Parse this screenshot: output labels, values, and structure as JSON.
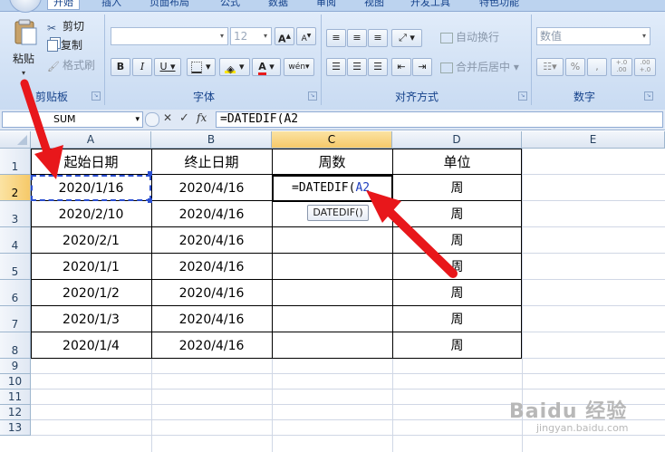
{
  "ribbon": {
    "tabs": [
      "开始",
      "插入",
      "页面布局",
      "公式",
      "数据",
      "审阅",
      "视图",
      "开发工具",
      "特色功能"
    ],
    "clipboard": {
      "paste": "粘贴",
      "cut": "剪切",
      "copy": "复制",
      "format_painter": "格式刷",
      "group": "剪贴板"
    },
    "font": {
      "font_size": "12",
      "bold": "B",
      "italic": "I",
      "underline": "U",
      "grow": "A",
      "shrink": "A",
      "group": "字体",
      "font_color_letter": "A",
      "phonetic": "wén"
    },
    "alignment": {
      "wrap": "自动换行",
      "merge": "合并后居中",
      "group": "对齐方式"
    },
    "number": {
      "format": "数值",
      "percent": "%",
      "comma": ",",
      "inc_decimal": "+.0\n.00",
      "dec_decimal": ".00\n+.0",
      "group": "数字"
    }
  },
  "formula_bar": {
    "name_box": "SUM",
    "cancel": "✕",
    "enter": "✓",
    "fx": "fx",
    "formula": "=DATEDIF(A2"
  },
  "grid": {
    "columns": [
      "A",
      "B",
      "C",
      "D",
      "E"
    ],
    "rows": [
      "1",
      "2",
      "3",
      "4",
      "5",
      "6",
      "7",
      "8",
      "9",
      "10",
      "11",
      "12",
      "13"
    ],
    "header_row": [
      "起始日期",
      "终止日期",
      "周数",
      "单位"
    ],
    "data_rows": [
      [
        "2020/1/16",
        "2020/4/16",
        "=DATEDIF(A2",
        "周"
      ],
      [
        "2020/2/10",
        "2020/4/16",
        "",
        "周"
      ],
      [
        "2020/2/1",
        "2020/4/16",
        "",
        "周"
      ],
      [
        "2020/1/1",
        "2020/4/16",
        "",
        "周"
      ],
      [
        "2020/1/2",
        "2020/4/16",
        "",
        "周"
      ],
      [
        "2020/1/3",
        "2020/4/16",
        "",
        "周"
      ],
      [
        "2020/1/4",
        "2020/4/16",
        "",
        "周"
      ]
    ],
    "active_cell": "C2",
    "formula_prefix": "=DATEDIF(",
    "formula_ref": "A2",
    "ref_color": "#1f3fbf"
  },
  "tooltip": "DATEDIF()",
  "watermark": "Baidu 经验",
  "watermark_url": "jingyan.baidu.com",
  "colors": {
    "arrow": "#e8171b",
    "selection_header": "#f6c969",
    "ribbon": "#d3e2f5"
  }
}
